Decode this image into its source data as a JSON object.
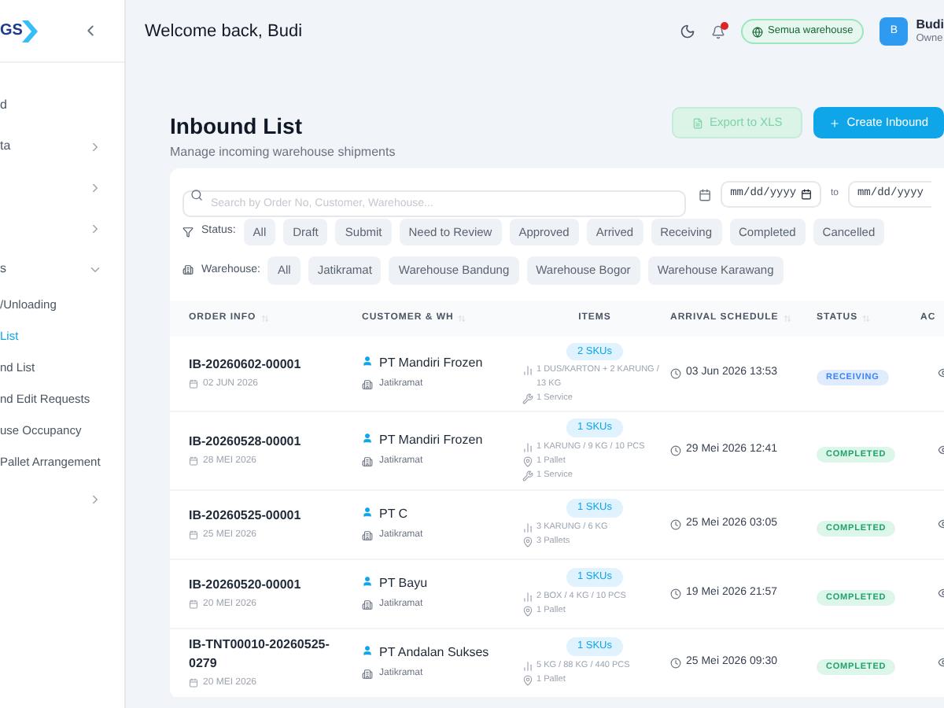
{
  "sidebar": {
    "logo_text": "GS",
    "items": [
      {
        "label": "d"
      },
      {
        "label": "ta",
        "expanded": false
      },
      {
        "expanded": false
      },
      {
        "expanded": false
      },
      {
        "label": "s",
        "expanded": true,
        "children": [
          {
            "label": "/Unloading",
            "selected": false
          },
          {
            "label": "List",
            "selected": true
          },
          {
            "label": "nd List",
            "selected": false
          },
          {
            "label": "nd Edit Requests",
            "selected": false
          },
          {
            "label": "use Occupancy",
            "selected": false
          },
          {
            "label": "Pallet Arrangement",
            "selected": false
          }
        ]
      },
      {
        "expanded": false
      }
    ]
  },
  "header": {
    "welcome": "Welcome back, Budi",
    "notification_dot": true,
    "warehouse": "Semua warehouse",
    "avatar": "B",
    "user_name": "Budi",
    "user_role": "Owne"
  },
  "page": {
    "title": "Inbound List",
    "subtitle": "Manage incoming warehouse shipments",
    "export_button": {
      "label": "Export to XLS",
      "disabled": true
    },
    "create_button": "Create Inbound"
  },
  "filters": {
    "search_placeholder": "Search by Order No, Customer, Warehouse...",
    "date_from_placeholder": "mm/dd/yyyy",
    "to_label": "to",
    "date_to_placeholder": "mm/dd/yyyy",
    "status_label": "Status:",
    "status_options": [
      {
        "label": "All",
        "selected": false
      },
      {
        "label": "Draft",
        "selected": false
      },
      {
        "label": "Submit",
        "selected": false
      },
      {
        "label": "Need to Review",
        "selected": false
      },
      {
        "label": "Approved",
        "selected": false
      },
      {
        "label": "Arrived",
        "selected": false
      },
      {
        "label": "Receiving",
        "selected": false
      },
      {
        "label": "Completed",
        "selected": false
      },
      {
        "label": "Cancelled",
        "selected": false
      }
    ],
    "warehouse_label": "Warehouse:",
    "warehouse_options": [
      {
        "label": "All",
        "selected": false
      },
      {
        "label": "Jatikramat",
        "selected": false
      },
      {
        "label": "Warehouse Bandung",
        "selected": false
      },
      {
        "label": "Warehouse Bogor",
        "selected": false
      },
      {
        "label": "Warehouse Karawang",
        "selected": false
      }
    ]
  },
  "table": {
    "columns": [
      {
        "label": "ORDER INFO",
        "sortable": true
      },
      {
        "label": "CUSTOMER & WH",
        "sortable": true
      },
      {
        "label": "ITEMS",
        "sortable": false
      },
      {
        "label": "ARRIVAL SCHEDULE",
        "sortable": true
      },
      {
        "label": "STATUS",
        "sortable": true
      },
      {
        "label": "AC",
        "sortable": false
      }
    ],
    "rows": [
      {
        "order_no": "IB-20260602-00001",
        "date": "02 JUN 2026",
        "customer": "PT Mandiri Frozen",
        "warehouse": "Jatikramat",
        "skus": "2 SKUs",
        "items": [
          {
            "kind": "quantity",
            "text": "1 DUS/KARTON + 2 KARUNG / 13 KG"
          },
          {
            "kind": "service",
            "text": "1 Service"
          }
        ],
        "arrival": "03 Jun 2026 13:53",
        "status": {
          "kind": "receiving",
          "label": "RECEIVING"
        }
      },
      {
        "order_no": "IB-20260528-00001",
        "date": "28 MEI 2026",
        "customer": "PT Mandiri Frozen",
        "warehouse": "Jatikramat",
        "skus": "1 SKUs",
        "items": [
          {
            "kind": "quantity",
            "text": "1 KARUNG / 9 KG / 10 PCS"
          },
          {
            "kind": "pallet",
            "text": "1 Pallet"
          },
          {
            "kind": "service",
            "text": "1 Service"
          }
        ],
        "arrival": "29 Mei 2026 12:41",
        "status": {
          "kind": "completed",
          "label": "COMPLETED"
        }
      },
      {
        "order_no": "IB-20260525-00001",
        "date": "25 MEI 2026",
        "customer": "PT C",
        "warehouse": "Jatikramat",
        "skus": "1 SKUs",
        "items": [
          {
            "kind": "quantity",
            "text": "3 KARUNG / 6 KG"
          },
          {
            "kind": "pallet",
            "text": "3 Pallets"
          }
        ],
        "arrival": "25 Mei 2026 03:05",
        "status": {
          "kind": "completed",
          "label": "COMPLETED"
        }
      },
      {
        "order_no": "IB-20260520-00001",
        "date": "20 MEI 2026",
        "customer": "PT Bayu",
        "warehouse": "Jatikramat",
        "skus": "1 SKUs",
        "items": [
          {
            "kind": "quantity",
            "text": "2 BOX / 4 KG / 10 PCS"
          },
          {
            "kind": "pallet",
            "text": "1 Pallet"
          }
        ],
        "arrival": "19 Mei 2026 21:57",
        "status": {
          "kind": "completed",
          "label": "COMPLETED"
        }
      },
      {
        "order_no": "IB-TNT00010-20260525-0279",
        "date": "20 MEI 2026",
        "customer": "PT Andalan Sukses",
        "warehouse": "Jatikramat",
        "skus": "1 SKUs",
        "items": [
          {
            "kind": "quantity",
            "text": "5 KG / 88 KG / 440 PCS"
          },
          {
            "kind": "pallet",
            "text": "1 Pallet"
          }
        ],
        "arrival": "25 Mei 2026 09:30",
        "status": {
          "kind": "completed",
          "label": "COMPLETED"
        }
      }
    ]
  }
}
